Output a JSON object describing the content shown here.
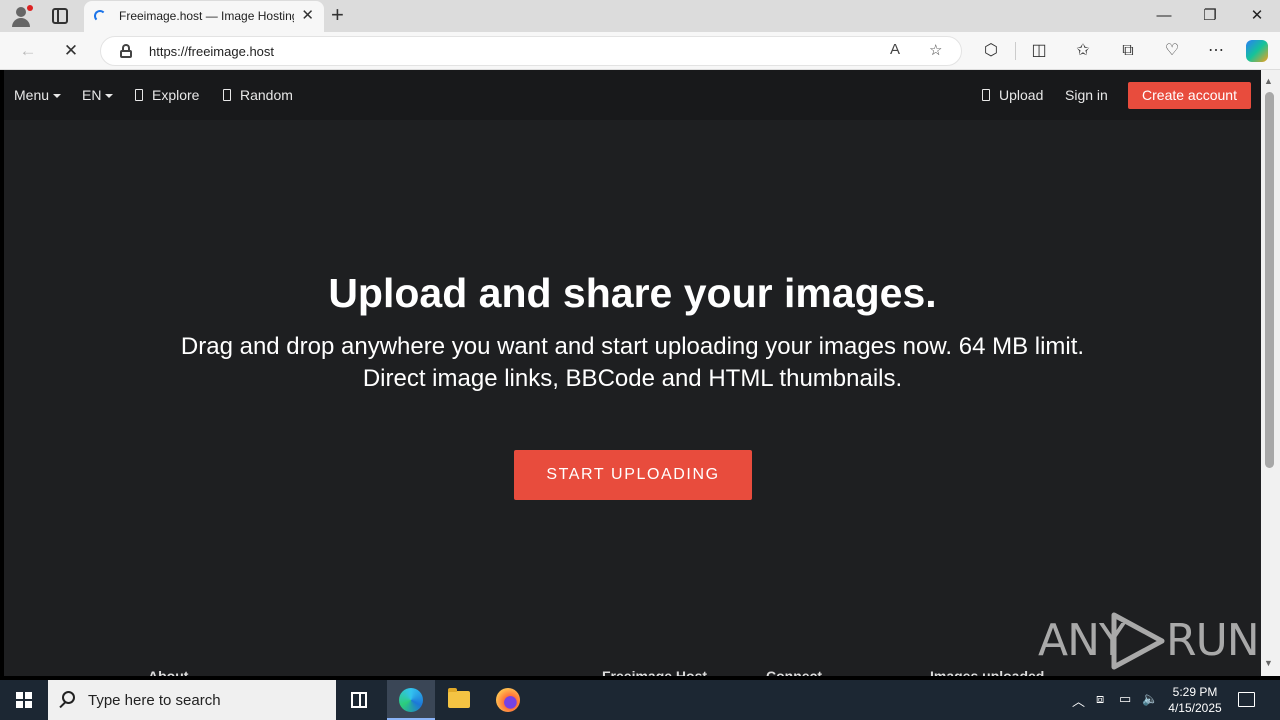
{
  "browser": {
    "tab_title": "Freeimage.host — Image Hosting",
    "url": "https://freeimage.host"
  },
  "site": {
    "nav": {
      "menu": "Menu",
      "language": "EN",
      "explore": "Explore",
      "random": "Random",
      "upload": "Upload",
      "sign_in": "Sign in",
      "create_account": "Create account"
    },
    "hero": {
      "title": "Upload and share your images.",
      "subtitle_line1": "Drag and drop anywhere you want and start uploading your images now. 64 MB limit.",
      "subtitle_line2": "Direct image links, BBCode and HTML thumbnails.",
      "cta": "START UPLOADING"
    },
    "footer": {
      "about": "About",
      "freeimage": "Freeimage.Host",
      "connect": "Connect",
      "images_uploaded": "Images uploaded"
    },
    "accent_color": "#e84c3d"
  },
  "watermark": {
    "left": "ANY",
    "right": "RUN"
  },
  "taskbar": {
    "search_placeholder": "Type here to search",
    "time": "5:29 PM",
    "date": "4/15/2025"
  }
}
